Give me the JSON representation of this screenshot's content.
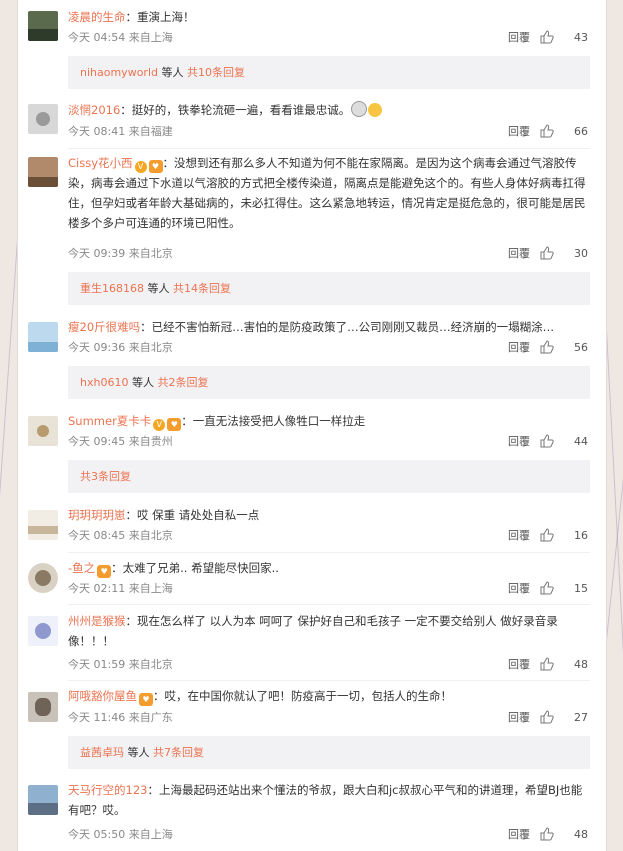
{
  "comments": [
    {
      "user": "凌晨的生命",
      "vip": false,
      "badge": false,
      "text": "：重演上海！",
      "emoji": false,
      "time": "今天 04:54",
      "loc": "来自上海",
      "reply": "回覆",
      "likes": "43",
      "sub": {
        "user": "nihaomyworld",
        "mid": " 等人 ",
        "count": "共10条回复"
      }
    },
    {
      "user": "淡惘2016",
      "vip": false,
      "badge": false,
      "text": "：挺好的，铁拳轮流砸一遍，看看谁最忠诚。",
      "emoji": true,
      "time": "今天 08:41",
      "loc": "来自福建",
      "reply": "回覆",
      "likes": "66",
      "sub": null
    },
    {
      "user": "Cissy花小西",
      "vip": true,
      "badge": true,
      "text": "：没想到还有那么多人不知道为何不能在家隔离。是因为这个病毒会通过气溶胶传染，病毒会通过下水道以气溶胶的方式把全楼传染道，隔离点是能避免这个的。有些人身体好病毒扛得住，但孕妇或者年龄大基础病的，未必扛得住。这么紧急地转运，情况肯定是挺危急的，很可能是居民楼多个多户可连通的环境已阳性。",
      "emoji": false,
      "time": "今天 09:39",
      "loc": "来自北京",
      "reply": "回覆",
      "likes": "30",
      "sub": {
        "user": "重生168168",
        "mid": " 等人 ",
        "count": "共14条回复"
      }
    },
    {
      "user": "瘦20斤很难吗",
      "vip": false,
      "badge": false,
      "text": "：已经不害怕新冠…害怕的是防疫政策了…公司刚刚又裁员…经济崩的一塌糊涂…",
      "emoji": false,
      "time": "今天 09:36",
      "loc": "来自北京",
      "reply": "回覆",
      "likes": "56",
      "sub": {
        "user": "hxh0610",
        "mid": " 等人 ",
        "count": "共2条回复"
      }
    },
    {
      "user": "Summer夏卡卡",
      "vip": true,
      "badge": true,
      "text": "：一直无法接受把人像牲口一样拉走",
      "emoji": false,
      "time": "今天 09:45",
      "loc": "来自贵州",
      "reply": "回覆",
      "likes": "44",
      "sub": {
        "user": "",
        "mid": "",
        "count": "共3条回复"
      }
    },
    {
      "user": "玥玥玥玥崽",
      "vip": false,
      "badge": false,
      "text": "：哎 保重 请处处自私一点",
      "emoji": false,
      "time": "今天 08:45",
      "loc": "来自北京",
      "reply": "回覆",
      "likes": "16",
      "sub": null
    },
    {
      "user": "-鱼之",
      "vip": false,
      "badge": true,
      "text": "：太难了兄弟.. 希望能尽快回家..",
      "emoji": false,
      "time": "今天 02:11",
      "loc": "来自上海",
      "reply": "回覆",
      "likes": "15",
      "sub": null
    },
    {
      "user": "州州是猴猴",
      "vip": false,
      "badge": false,
      "text": "：现在怎么样了 以人为本 呵呵了 保护好自己和毛孩子 一定不要交给别人 做好录音录像！！！",
      "emoji": false,
      "time": "今天 01:59",
      "loc": "来自北京",
      "reply": "回覆",
      "likes": "48",
      "sub": null
    },
    {
      "user": "阿哦豁你屋鱼",
      "vip": false,
      "badge": true,
      "text": "：哎，在中国你就认了吧！防疫高于一切，包括人的生命！",
      "emoji": false,
      "time": "今天 11:46",
      "loc": "来自广东",
      "reply": "回覆",
      "likes": "27",
      "sub": {
        "user": "益茜卓玛",
        "mid": " 等人 ",
        "count": "共7条回复"
      }
    },
    {
      "user": "天马行空的123",
      "vip": false,
      "badge": false,
      "text": "：上海最起码还站出来个懂法的爷叔，跟大白和jc叔叔心平气和的讲道理，希望BJ也能有吧？哎。",
      "emoji": false,
      "time": "今天 05:50",
      "loc": "来自上海",
      "reply": "回覆",
      "likes": "48",
      "sub": null
    }
  ],
  "colors": {
    "username": "#eb7350",
    "meta": "#888888",
    "subbg": "#f2f2f5"
  }
}
